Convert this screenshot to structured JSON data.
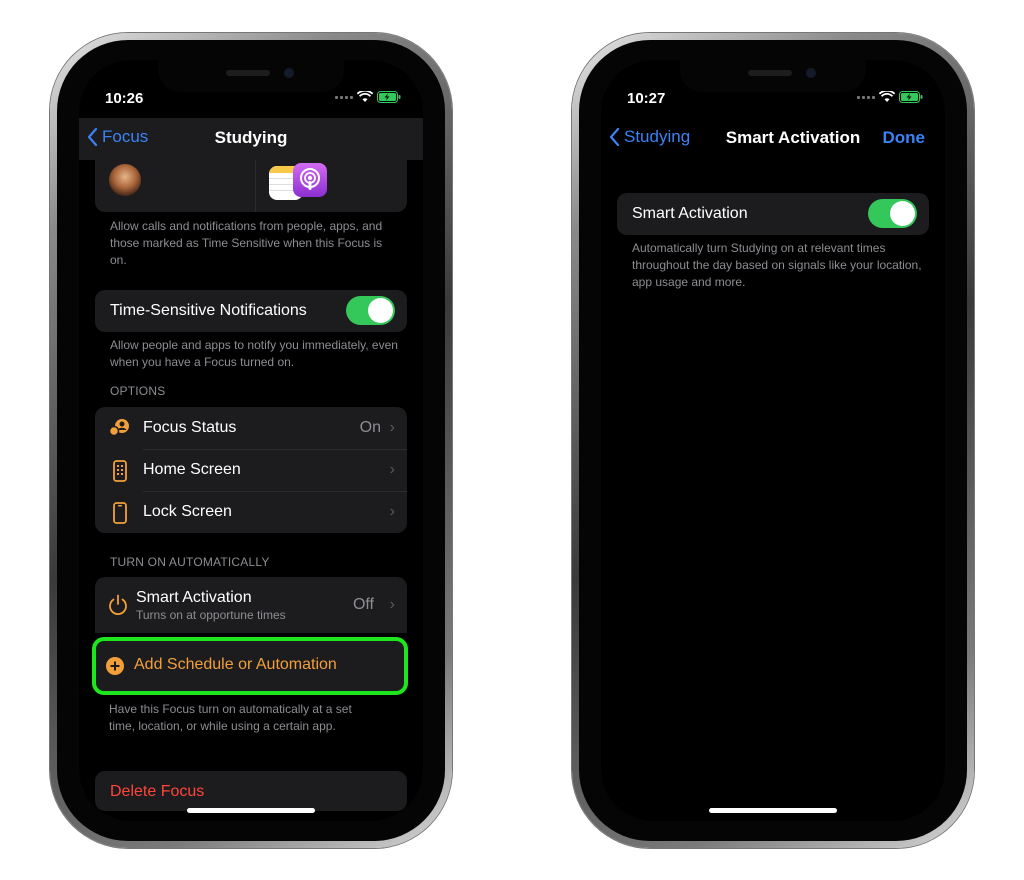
{
  "left": {
    "status_time": "10:26",
    "nav": {
      "back_label": "Focus",
      "title": "Studying"
    },
    "allow_footer": "Allow calls and notifications from people, apps, and those marked as Time Sensitive when this Focus is on.",
    "time_sensitive": {
      "label": "Time-Sensitive Notifications",
      "enabled": true,
      "footer": "Allow people and apps to notify you immediately, even when you have a Focus turned on."
    },
    "options_header": "OPTIONS",
    "options": [
      {
        "label": "Focus Status",
        "value": "On",
        "icon": "focus-status-icon"
      },
      {
        "label": "Home Screen",
        "value": "",
        "icon": "home-screen-icon"
      },
      {
        "label": "Lock Screen",
        "value": "",
        "icon": "lock-screen-icon"
      }
    ],
    "auto_header": "TURN ON AUTOMATICALLY",
    "smart_activation": {
      "label": "Smart Activation",
      "subtitle": "Turns on at opportune times",
      "value": "Off"
    },
    "add_schedule": {
      "label": "Add Schedule or Automation"
    },
    "auto_footer": "Have this Focus turn on automatically at a set time, location, or while using a certain app.",
    "delete_label": "Delete Focus"
  },
  "right": {
    "status_time": "10:27",
    "nav": {
      "back_label": "Studying",
      "title": "Smart Activation",
      "done_label": "Done"
    },
    "smart_activation": {
      "label": "Smart Activation",
      "enabled": true,
      "footer": "Automatically turn Studying on at relevant times throughout the day based on signals like your location, app usage and more."
    }
  },
  "colors": {
    "accent_blue": "#3b82f6",
    "toggle_green": "#34c759",
    "accent_orange": "#f29f3a",
    "highlight_green": "#1ee61e",
    "destructive_red": "#ff453a"
  }
}
